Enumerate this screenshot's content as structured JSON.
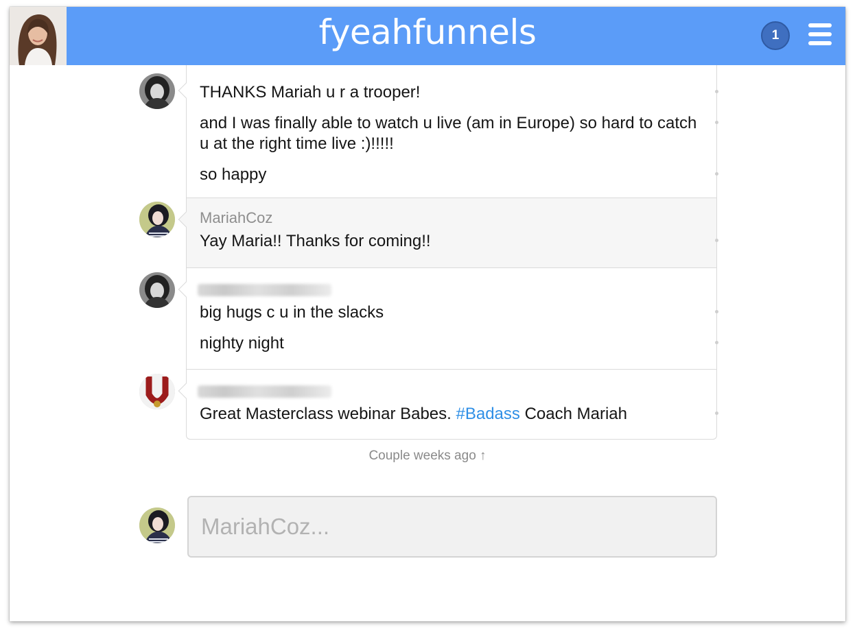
{
  "header": {
    "brand": "fyeahfunnels",
    "notification_count": "1",
    "avatar_icon": "user-photo-icon",
    "menu_icon": "hamburger-menu-icon"
  },
  "colors": {
    "header_bg": "#5b9cf8",
    "badge_bg": "#3f6fc0",
    "hashtag": "#2f8fe6"
  },
  "thread": {
    "groups": [
      {
        "author": "",
        "author_blurred": false,
        "messages": [
          "THANKS Mariah u r a trooper!",
          "and I was finally able to watch u live (am in Europe) so hard to catch u at the right time live :)!!!!!",
          "so happy"
        ]
      },
      {
        "author": "MariahCoz",
        "messages": [
          "Yay Maria!! Thanks for coming!!"
        ]
      },
      {
        "author_blurred": true,
        "messages": [
          "big hugs c u in the slacks",
          "nighty night"
        ]
      },
      {
        "author_blurred": true,
        "messages": [
          {
            "before": "Great Masterclass webinar Babes. ",
            "hashtag": "#Badass",
            "after": " Coach Mariah"
          }
        ]
      }
    ]
  },
  "timestamp": "Couple weeks ago ↑",
  "composer": {
    "placeholder": "MariahCoz..."
  }
}
